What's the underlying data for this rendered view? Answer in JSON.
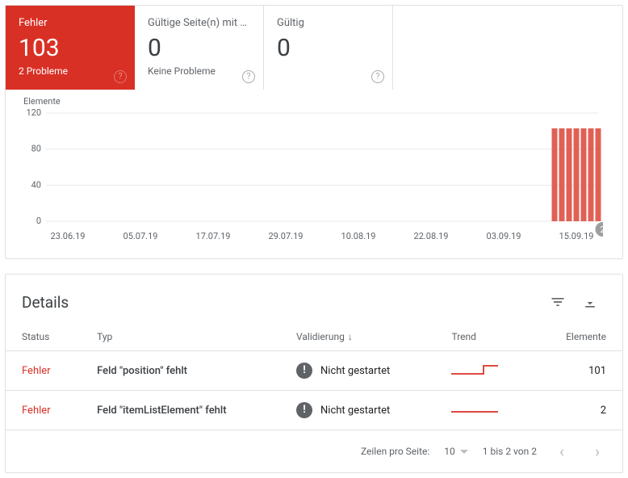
{
  "tiles": {
    "error": {
      "label": "Fehler",
      "value": "103",
      "sub": "2 Probleme"
    },
    "warning": {
      "label": "Gültige Seite(n) mit …",
      "value": "0",
      "sub": "Keine Probleme"
    },
    "valid": {
      "label": "Gültig",
      "value": "0",
      "sub": ""
    }
  },
  "chart": {
    "ylabel": "Elemente",
    "annotation": "2"
  },
  "chart_data": {
    "type": "bar",
    "categories": [
      "23.06.19",
      "05.07.19",
      "17.07.19",
      "29.07.19",
      "10.08.19",
      "22.08.19",
      "03.09.19",
      "15.09.19"
    ],
    "values": [
      0,
      0,
      0,
      0,
      0,
      0,
      0,
      103
    ],
    "title": "Elemente",
    "xlabel": "",
    "ylabel": "Elemente",
    "ylim": [
      0,
      120
    ],
    "yticks": [
      0,
      40,
      80,
      120
    ]
  },
  "details": {
    "title": "Details",
    "cols": {
      "status": "Status",
      "typ": "Typ",
      "validierung": "Validierung",
      "trend": "Trend",
      "elemente": "Elemente"
    },
    "rows": [
      {
        "status": "Fehler",
        "typ": "Feld \"position\" fehlt",
        "val": "Nicht gestartet",
        "elemente": "101",
        "trend": "step"
      },
      {
        "status": "Fehler",
        "typ": "Feld \"itemListElement\" fehlt",
        "val": "Nicht gestartet",
        "elemente": "2",
        "trend": "flat"
      }
    ],
    "pager": {
      "rpp_label": "Zeilen pro Seite:",
      "rpp_value": "10",
      "range": "1 bis 2 von 2"
    }
  }
}
